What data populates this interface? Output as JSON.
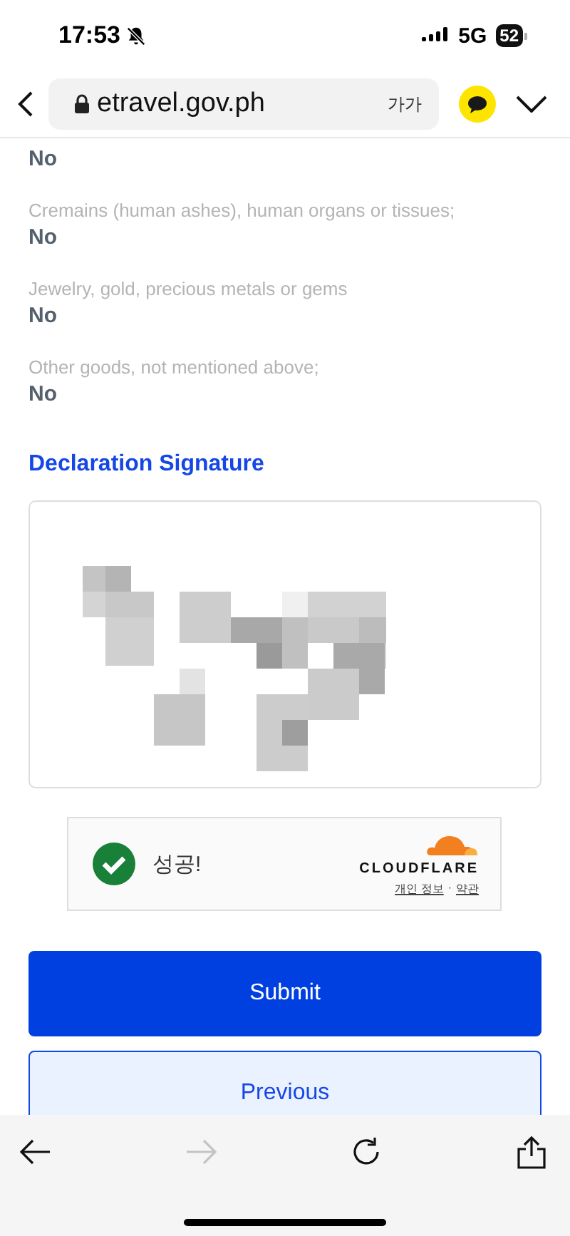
{
  "status_bar": {
    "time": "17:53",
    "network": "5G",
    "battery": "52"
  },
  "browser_bar": {
    "url": "etravel.gov.ph",
    "text_size": "가가"
  },
  "declarations": [
    {
      "answer": "No"
    },
    {
      "question": "Cremains (human ashes), human organs or tissues;",
      "answer": "No"
    },
    {
      "question": "Jewelry, gold, precious metals or gems",
      "answer": "No"
    },
    {
      "question": "Other goods, not mentioned above;",
      "answer": "No"
    }
  ],
  "signature_heading": "Declaration Signature",
  "captcha": {
    "status": "성공!",
    "verified": true,
    "brand": "CLOUDFLARE",
    "privacy_link": "개인 정보",
    "separator": "·",
    "terms_link": "약관"
  },
  "buttons": [
    {
      "label": "Submit",
      "kind": "primary"
    },
    {
      "label": "Previous",
      "kind": "secondary"
    }
  ],
  "toolbar": {
    "forward_disabled": true
  }
}
